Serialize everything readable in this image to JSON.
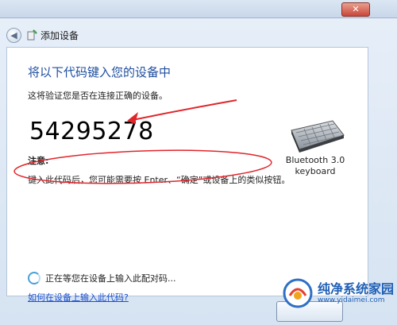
{
  "window": {
    "title": "添加设备"
  },
  "dialog": {
    "heading": "将以下代码键入您的设备中",
    "subtext": "这将验证您是否在连接正确的设备。",
    "pairing_code": "54295278",
    "note_label": "注意:",
    "note_text": "键入此代码后，您可能需要按 Enter、“确定”或设备上的类似按钮。",
    "waiting_text": "正在等您在设备上输入此配对码...",
    "help_link": "如何在设备上输入此代码?"
  },
  "device": {
    "name_line1": "Bluetooth 3.0",
    "name_line2": "keyboard"
  },
  "watermark": {
    "name": "纯净系统家园",
    "url": "www.yidaimei.com"
  },
  "annotation_color": "#e0262b"
}
